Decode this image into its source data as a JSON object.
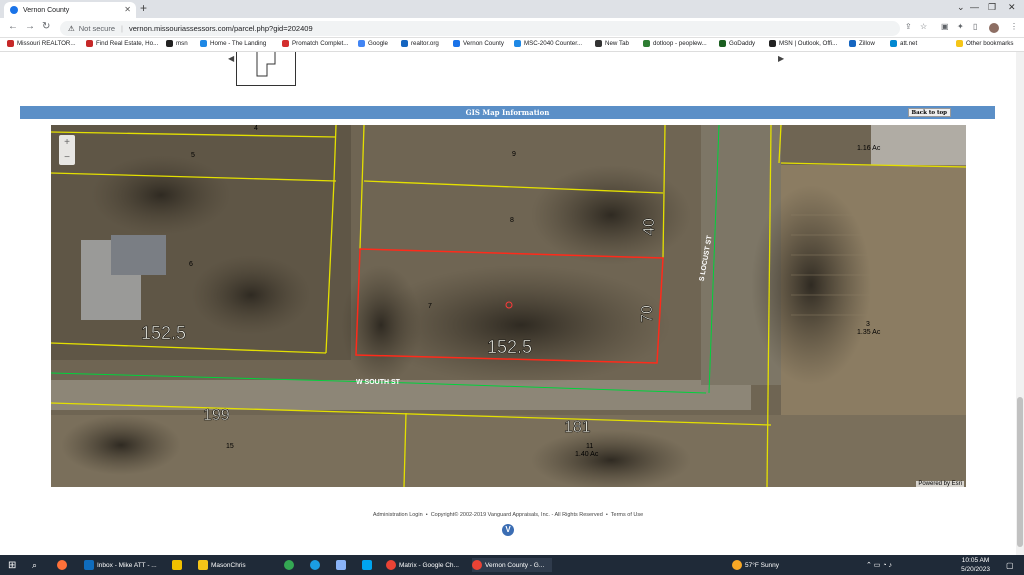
{
  "browser": {
    "tab_title": "Vernon County",
    "url_security": "Not secure",
    "url": "vernon.missouriassessors.com/parcel.php?gid=202409"
  },
  "bookmarks": [
    {
      "label": "Missouri REALTOR...",
      "color": "#c62828"
    },
    {
      "label": "Find Real Estate, Ho...",
      "color": "#c62828"
    },
    {
      "label": "msn",
      "color": "#222222"
    },
    {
      "label": "Home - The Landing",
      "color": "#1e88e5"
    },
    {
      "label": "Promatch Complet...",
      "color": "#d32f2f"
    },
    {
      "label": "Google",
      "color": "#4285f4"
    },
    {
      "label": "realtor.org",
      "color": "#1565c0"
    },
    {
      "label": "Vernon County",
      "color": "#1a73e8"
    },
    {
      "label": "MSC-2040 Counter...",
      "color": "#1e88e5"
    },
    {
      "label": "New Tab",
      "color": "#333333"
    },
    {
      "label": "dotloop - peoplew...",
      "color": "#2e7d32"
    },
    {
      "label": "GoDaddy",
      "color": "#1b5e20"
    },
    {
      "label": "MSN | Outlook, Offi...",
      "color": "#222222"
    },
    {
      "label": "Zillow",
      "color": "#1565c0"
    },
    {
      "label": "att.net",
      "color": "#0288d1"
    }
  ],
  "other_bookmarks": "Other bookmarks",
  "gis": {
    "title": "GIS Map Information",
    "back_to_top": "Back to top",
    "powered_by": "Powered by Esri",
    "zoom_in": "+",
    "zoom_out": "−"
  },
  "map_labels": {
    "dim_top": "40",
    "dim_right": "70",
    "dim_bottom_selected": "152.5",
    "dim_left_parcel": "152.5",
    "dim_199": "199",
    "dim_181": "181",
    "street_south": "W SOUTH ST",
    "street_locust": "S LOCUST ST",
    "parcel_4": "4",
    "parcel_5": "5",
    "parcel_6": "6",
    "parcel_7": "7",
    "parcel_8": "8",
    "parcel_9": "9",
    "parcel_15": "15",
    "parcel_11": "11",
    "parcel_11_acres": "1.40 Ac",
    "parcel_3": "3",
    "parcel_3_acres": "1.35 Ac",
    "parcel_top_right": "1.16 Ac"
  },
  "footer": {
    "admin_login": "Administration Login",
    "copyright": "Copyright© 2002-2019 Vanguard Appraisals, Inc. - All Rights Reserved",
    "terms": "Terms of Use"
  },
  "taskbar": {
    "outlook": "Inbox - Mike ATT - ...",
    "folder": "MasonChris",
    "chrome_matrix": "Matrix - Google Ch...",
    "chrome_vernon": "Vernon County - G...",
    "weather": "57°F  Sunny",
    "time": "10:05 AM",
    "date": "5/20/2023"
  }
}
